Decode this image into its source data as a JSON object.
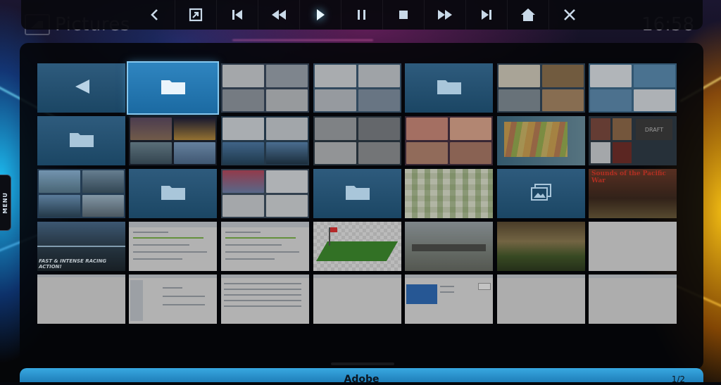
{
  "header": {
    "title": "Pictures",
    "clock": "16:58"
  },
  "osd": {
    "buttons": [
      {
        "name": "back-button",
        "icon": "chevron-left-icon"
      },
      {
        "name": "fullscreen-button",
        "icon": "fullscreen-icon"
      },
      {
        "name": "skip-previous-button",
        "icon": "skip-previous-icon"
      },
      {
        "name": "rewind-button",
        "icon": "rewind-icon"
      },
      {
        "name": "play-button",
        "icon": "play-icon"
      },
      {
        "name": "pause-button",
        "icon": "pause-icon"
      },
      {
        "name": "stop-button",
        "icon": "stop-icon"
      },
      {
        "name": "fast-forward-button",
        "icon": "fast-forward-icon"
      },
      {
        "name": "skip-next-button",
        "icon": "skip-next-icon"
      },
      {
        "name": "home-button",
        "icon": "home-icon"
      },
      {
        "name": "close-button",
        "icon": "close-icon"
      }
    ]
  },
  "menu_tab": {
    "label": "MENU"
  },
  "grid": {
    "tile_labels": {
      "draft": "DRAFT",
      "poster_title": "Sounds of the Pacific War",
      "game_caption": "FAST & INTENSE RACING ACTION!"
    }
  },
  "footer": {
    "label": "Adobe",
    "page": "1/2"
  },
  "colors": {
    "accent": "#2a95d2",
    "folder_tile": "#1f5273",
    "selected_tile": "#2a7fba"
  }
}
